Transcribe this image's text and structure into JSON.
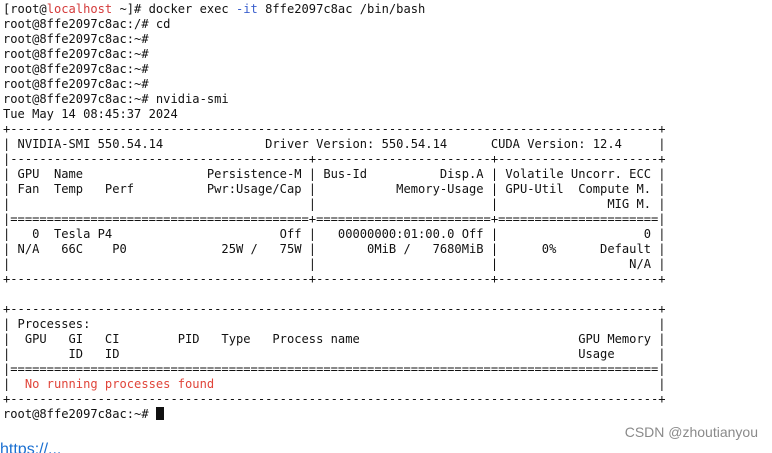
{
  "terminal": {
    "prompt_before_host": "[root@",
    "host": "localhost",
    "prompt_after_host": " ~]# docker exec ",
    "exec_option": "-it",
    "exec_rest": " 8ffe2097c8ac /bin/bash",
    "lines": [
      "root@8ffe2097c8ac:/# cd",
      "root@8ffe2097c8ac:~#",
      "root@8ffe2097c8ac:~#",
      "root@8ffe2097c8ac:~#",
      "root@8ffe2097c8ac:~#",
      "root@8ffe2097c8ac:~# nvidia-smi",
      "Tue May 14 08:45:37 2024",
      "+-----------------------------------------------------------------------------------------+",
      "| NVIDIA-SMI 550.54.14              Driver Version: 550.54.14      CUDA Version: 12.4     |",
      "|-----------------------------------------+------------------------+----------------------+",
      "| GPU  Name                 Persistence-M | Bus-Id          Disp.A | Volatile Uncorr. ECC |",
      "| Fan  Temp   Perf          Pwr:Usage/Cap |           Memory-Usage | GPU-Util  Compute M. |",
      "|                                         |                        |               MIG M. |",
      "|=========================================+========================+======================|",
      "|   0  Tesla P4                       Off |   00000000:01:00.0 Off |                    0 |",
      "| N/A   66C    P0             25W /   75W |       0MiB /   7680MiB |      0%      Default |",
      "|                                         |                        |                  N/A |",
      "+-----------------------------------------+------------------------+----------------------+",
      "",
      "+-----------------------------------------------------------------------------------------+",
      "| Processes:                                                                              |",
      "|  GPU   GI   CI        PID   Type   Process name                              GPU Memory |",
      "|        ID   ID                                                               Usage      |",
      "|=========================================================================================|"
    ],
    "no_processes_prefix": "|  ",
    "no_processes_message": "No running processes found",
    "no_processes_suffix": "                                                             |",
    "footer_line": "+-----------------------------------------------------------------------------------------+",
    "final_prompt": "root@8ffe2097c8ac:~# "
  },
  "watermark": "CSDN @zhoutianyou",
  "below_text": "https://..."
}
